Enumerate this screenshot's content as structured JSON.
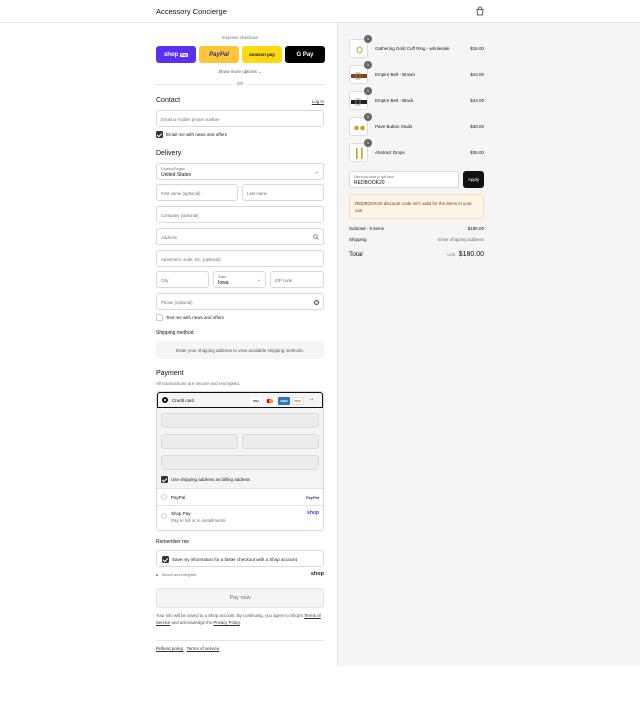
{
  "header": {
    "store_name": "Accessory Concierge",
    "cart_icon": "shopping-bag-icon"
  },
  "express": {
    "label": "Express checkout",
    "buttons": {
      "shop_pay": "shop",
      "shop_pay_badge": "Pay",
      "paypal": "PayPal",
      "amazon": "amazon pay",
      "google": "G Pay"
    },
    "show_more": "Show more options",
    "or": "OR"
  },
  "contact": {
    "title": "Contact",
    "login": "Log in",
    "email_placeholder": "Email or mobile phone number",
    "news_label": "Email me with news and offers"
  },
  "delivery": {
    "title": "Delivery",
    "country_label": "Country/Region",
    "country_value": "United States",
    "first_name": "First name (optional)",
    "last_name": "Last name",
    "company": "Company (optional)",
    "address": "Address",
    "apartment": "Apartment, suite, etc. (optional)",
    "city": "City",
    "state_label": "State",
    "state_value": "Iowa",
    "zip": "ZIP code",
    "phone": "Phone (optional)",
    "text_label": "Text me with news and offers"
  },
  "shipping_method": {
    "title": "Shipping method",
    "message": "Enter your shipping address to view available shipping methods."
  },
  "payment": {
    "title": "Payment",
    "subtitle": "All transactions are secure and encrypted.",
    "credit_card": "Credit card",
    "card_logos": [
      "VISA",
      "MC",
      "AMEX",
      "DISC"
    ],
    "billing_label": "Use shipping address as billing address",
    "paypal": "PayPal",
    "paypal_logo": "PayPal",
    "shop_pay": "Shop Pay",
    "shop_pay_sub": "Pay in full or in installments",
    "shop_logo": "shop"
  },
  "remember": {
    "title": "Remember me",
    "save_label": "Save my information for a faster checkout with a Shop account",
    "secure": "Secure and encrypted",
    "shop_logo": "shop"
  },
  "pay_now": "Pay now",
  "fine_print": {
    "part1": "Your info will be saved to a Shop account. By continuing, you agree to Shop's",
    "terms": "Terms of Service",
    "part2": "and acknowledge the",
    "privacy": "Privacy Policy",
    "end": "."
  },
  "footer": {
    "refund": "Refund policy",
    "terms": "Terms of service"
  },
  "cart": {
    "items": [
      {
        "name": "Gathering Gold Cuff Ring - wholesale",
        "price": "$16.00",
        "qty": "1"
      },
      {
        "name": "Empire Belt - Brown",
        "price": "$44.00",
        "qty": "1"
      },
      {
        "name": "Empire Belt - Black",
        "price": "$44.00",
        "qty": "1"
      },
      {
        "name": "Pave Button Studs",
        "price": "$36.00",
        "qty": "1"
      },
      {
        "name": "Abstract Drops",
        "price": "$36.00",
        "qty": "1"
      }
    ],
    "discount_label": "Discount code or gift card",
    "discount_value": "REDBOOK20",
    "apply": "Apply",
    "warning": "REDBOOK20 discount code isn't valid for the items in your cart",
    "subtotal_label": "Subtotal · 5 items",
    "subtotal_value": "$180.00",
    "shipping_label": "Shipping",
    "shipping_value": "Enter shipping address",
    "total_label": "Total",
    "currency": "USD",
    "total_value": "$180.00"
  }
}
